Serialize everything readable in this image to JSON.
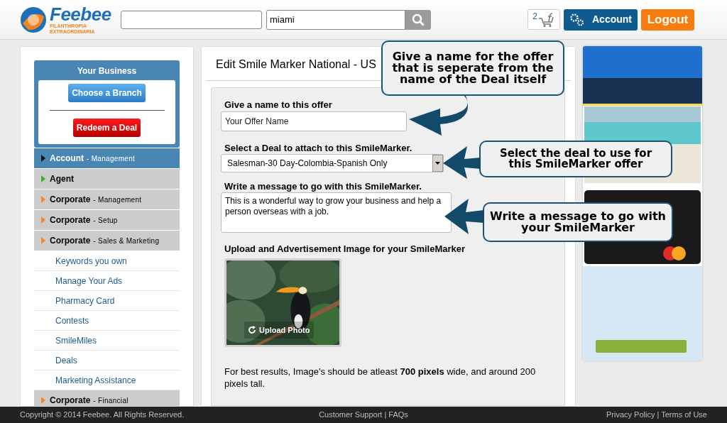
{
  "header": {
    "logo": {
      "name": "Feebee",
      "tagline_1": "FILANTHROPIA",
      "tagline_2": "EXTRAORDINARIA"
    },
    "search": {
      "location_value": "miami"
    },
    "cart_count": "2",
    "account_button": "Account",
    "logout_button": "Logout"
  },
  "sidebar": {
    "business_box": {
      "title": "Your Business",
      "choose_branch": "Choose a Branch",
      "redeem_deal": "Redeem a Deal"
    },
    "nav": [
      {
        "label": "Account",
        "sublabel": "- Management",
        "selected": true,
        "color": "#111111"
      },
      {
        "label": "Agent",
        "selected": false,
        "color": "#3bb02c"
      },
      {
        "label": "Corporate",
        "sublabel": "- Management",
        "selected": false,
        "color": "#f7862a"
      },
      {
        "label": "Corporate",
        "sublabel": "- Setup",
        "selected": false,
        "color": "#f7862a"
      },
      {
        "label": "Corporate",
        "sublabel": "- Sales & Marketing",
        "selected": false,
        "expanded": true,
        "color": "#f7862a",
        "children": [
          {
            "label": "Keywords you own"
          },
          {
            "label": "Manage Your Ads"
          },
          {
            "label": "Pharmacy Card"
          },
          {
            "label": "Contests"
          },
          {
            "label": "SmileMiles"
          },
          {
            "label": "Deals"
          },
          {
            "label": "Marketing Assistance"
          }
        ]
      },
      {
        "label": "Corporate",
        "sublabel": "- Financial",
        "selected": false,
        "color": "#f7862a"
      }
    ]
  },
  "main": {
    "title": "Edit Smile Marker National - US",
    "form": {
      "name_label": "Give a name to this offer",
      "name_placeholder": "Your Offer Name",
      "deal_label": "Select a Deal to attach to this SmileMarker.",
      "deal_value": "Salesman-30 Day-Colombia-Spanish Only",
      "message_label": "Write a message to go with this SmileMarker.",
      "message_value": "This is a wonderful way to grow your business and help a person overseas with a job.",
      "image_label": "Upload and Advertisement Image for your SmileMarker",
      "upload_button": "Upload Photo",
      "hint": "For best results, Image's should be atleast **700 pixels** wide, and around 200 pixels tall."
    }
  },
  "callouts": [
    {
      "text": "Give a name for the offer that is seperate from the name of the Deal itself"
    },
    {
      "text": "Select the deal to use for this SmileMarker offer"
    },
    {
      "text": "Write a message to go with your SmileMarker"
    }
  ],
  "footer": {
    "copyright": "Copyright © 2014 Feebee. All Rights Reserved.",
    "support_links": "Customer Support | FAQs",
    "legal_links": "Privacy Policy | Terms of Use"
  }
}
